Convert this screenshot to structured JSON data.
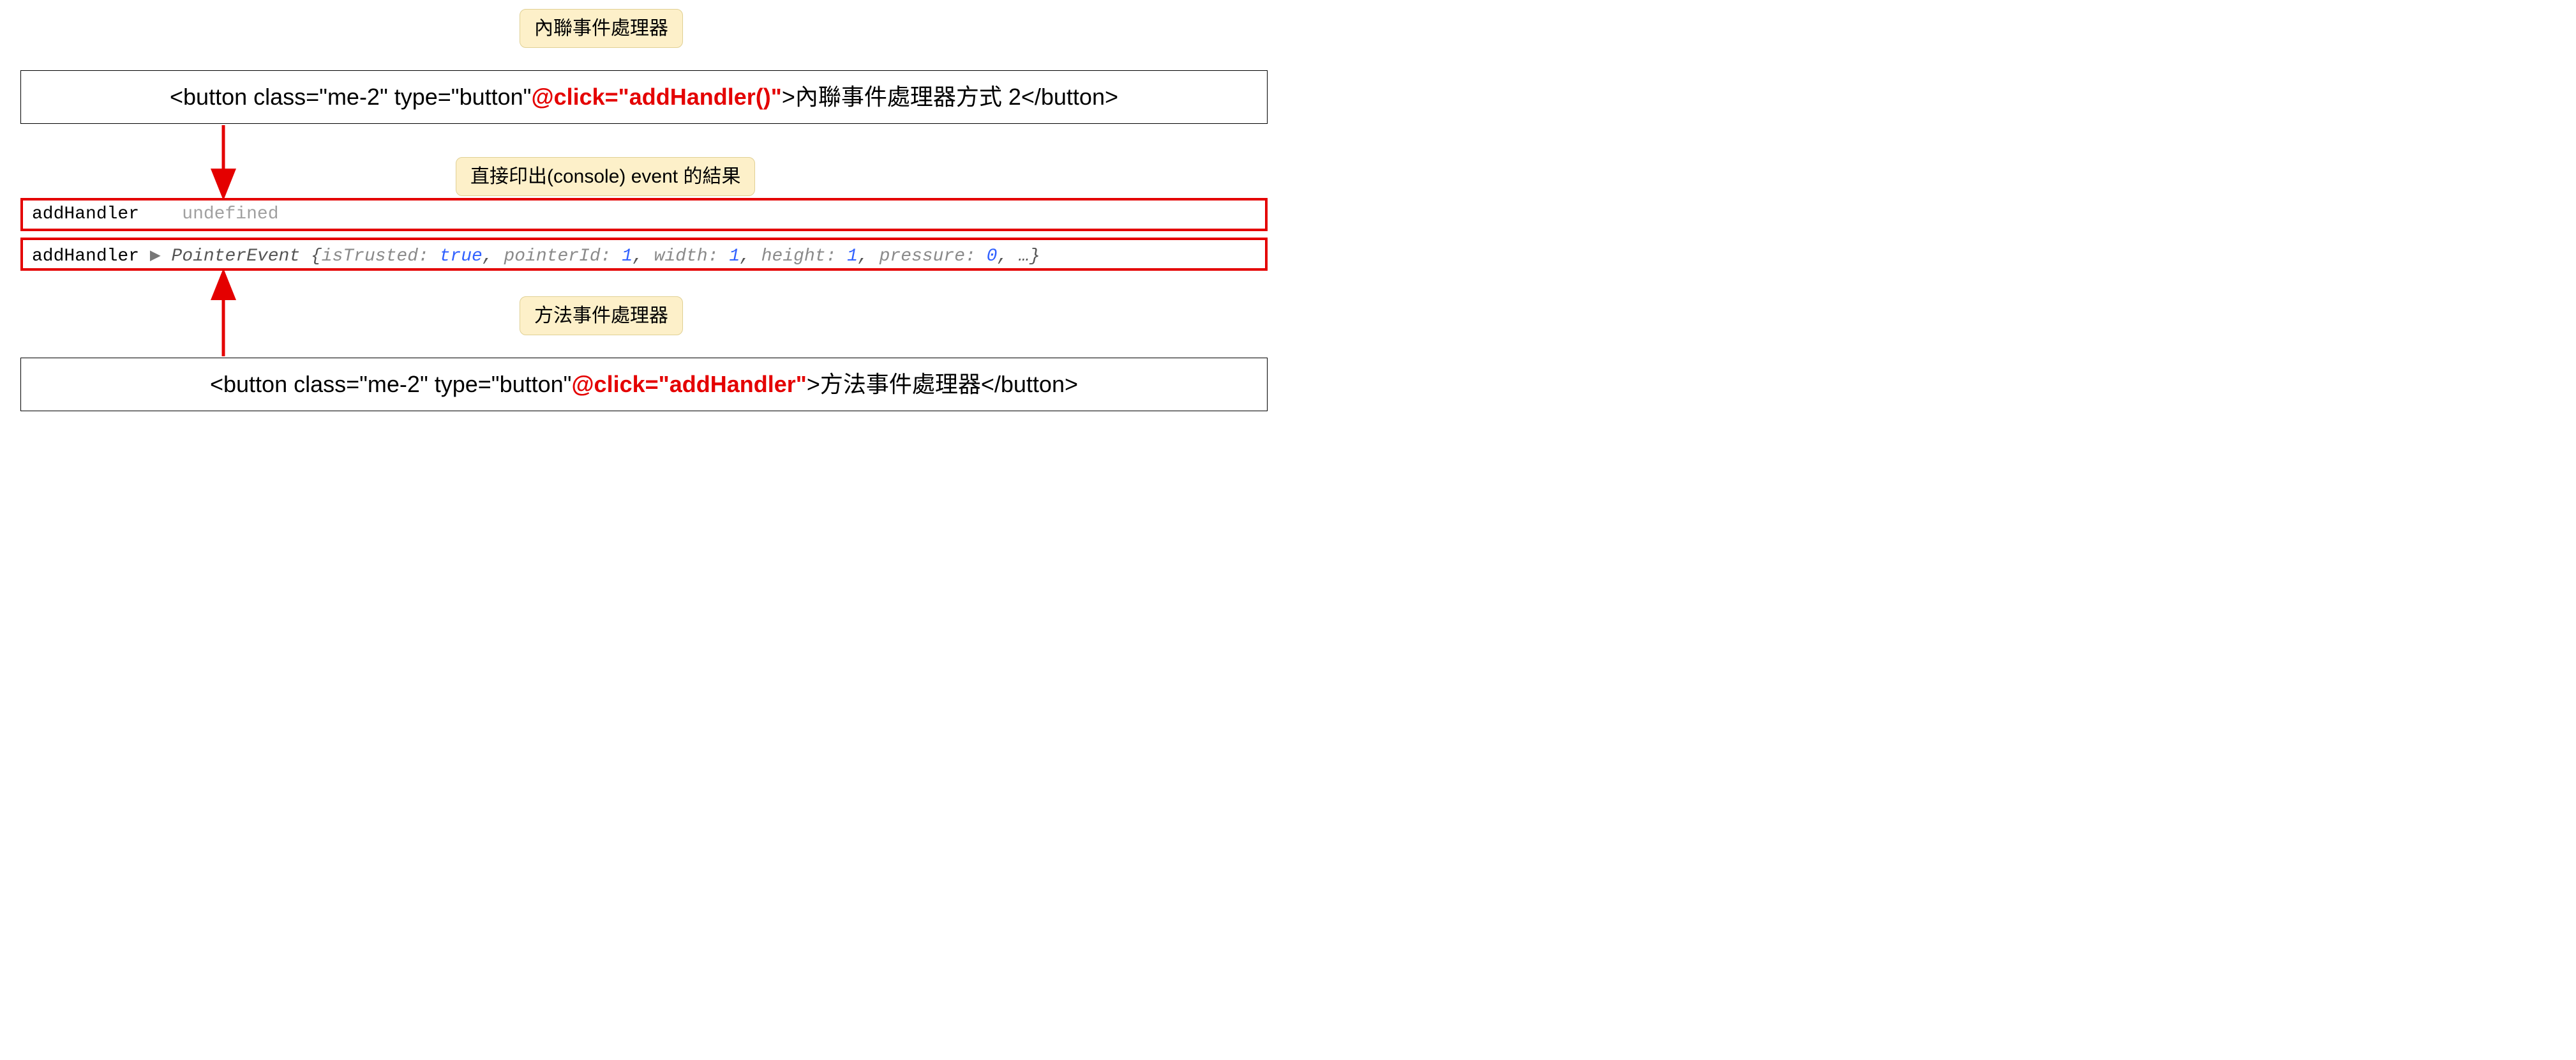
{
  "badges": {
    "top": "內聯事件處理器",
    "middle": "直接印出(console) event 的結果",
    "bottom": "方法事件處理器"
  },
  "codeBox1": {
    "pre": "<button class=\"me-2\" type=\"button\" ",
    "highlight": "@click=\"addHandler()\"",
    "post": ">內聯事件處理器方式 2</button>"
  },
  "codeBox2": {
    "pre": "<button class=\"me-2\" type=\"button\" ",
    "highlight": "@click=\"addHandler\"",
    "post": ">方法事件處理器</button>"
  },
  "console1": {
    "name": "addHandler",
    "value": "undefined"
  },
  "console2": {
    "name": "addHandler",
    "triangle": "▶",
    "cls": "PointerEvent",
    "open": "{",
    "props": [
      {
        "key": "isTrusted",
        "val": "true",
        "type": "bool"
      },
      {
        "key": "pointerId",
        "val": "1",
        "type": "num"
      },
      {
        "key": "width",
        "val": "1",
        "type": "num"
      },
      {
        "key": "height",
        "val": "1",
        "type": "num"
      },
      {
        "key": "pressure",
        "val": "0",
        "type": "num"
      }
    ],
    "ellipsis": "…",
    "close": "}"
  },
  "arrowColor": "#e40000"
}
